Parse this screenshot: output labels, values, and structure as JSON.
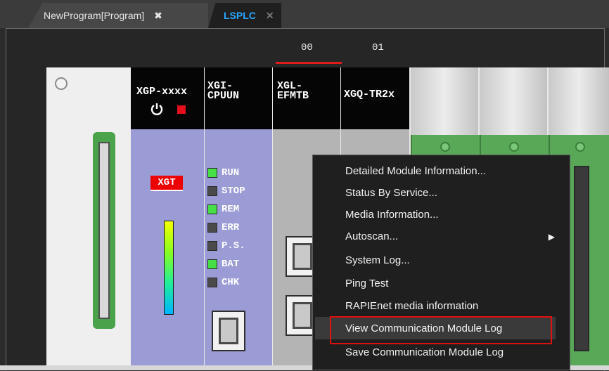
{
  "tabs": [
    {
      "label": "NewProgram[Program]",
      "close": "✖",
      "active": false
    },
    {
      "label": "LSPLC",
      "close": "✕",
      "active": true
    }
  ],
  "slots": [
    "00",
    "01"
  ],
  "modules": {
    "cpu": {
      "name": "XGP-xxxx",
      "badge": "XGT"
    },
    "cpuun": {
      "name": "XGI-\nCPUUN"
    },
    "enet": {
      "name": "XGL-\nEFMTB"
    },
    "tr": {
      "name": "XGQ-TR2x"
    }
  },
  "status_leds": [
    {
      "label": "RUN",
      "on": true
    },
    {
      "label": "STOP",
      "on": false
    },
    {
      "label": "REM",
      "on": true
    },
    {
      "label": "ERR",
      "on": false
    },
    {
      "label": "P.S.",
      "on": false
    },
    {
      "label": "BAT",
      "on": true
    },
    {
      "label": "CHK",
      "on": false
    }
  ],
  "context_menu": {
    "items": [
      "Detailed Module Information...",
      "Status By Service...",
      "Media Information...",
      "Autoscan...",
      "System Log...",
      "Ping Test",
      "RAPIEnet media information",
      "View Communication Module Log",
      "Save Communication Module Log"
    ],
    "submenu_arrow": "▶",
    "highlighted_index": 7
  },
  "colors": {
    "accent": "#2aa7ff",
    "highlight_box": "#e11010",
    "led_on": "#46e046",
    "led_off": "#4a4a4a"
  }
}
